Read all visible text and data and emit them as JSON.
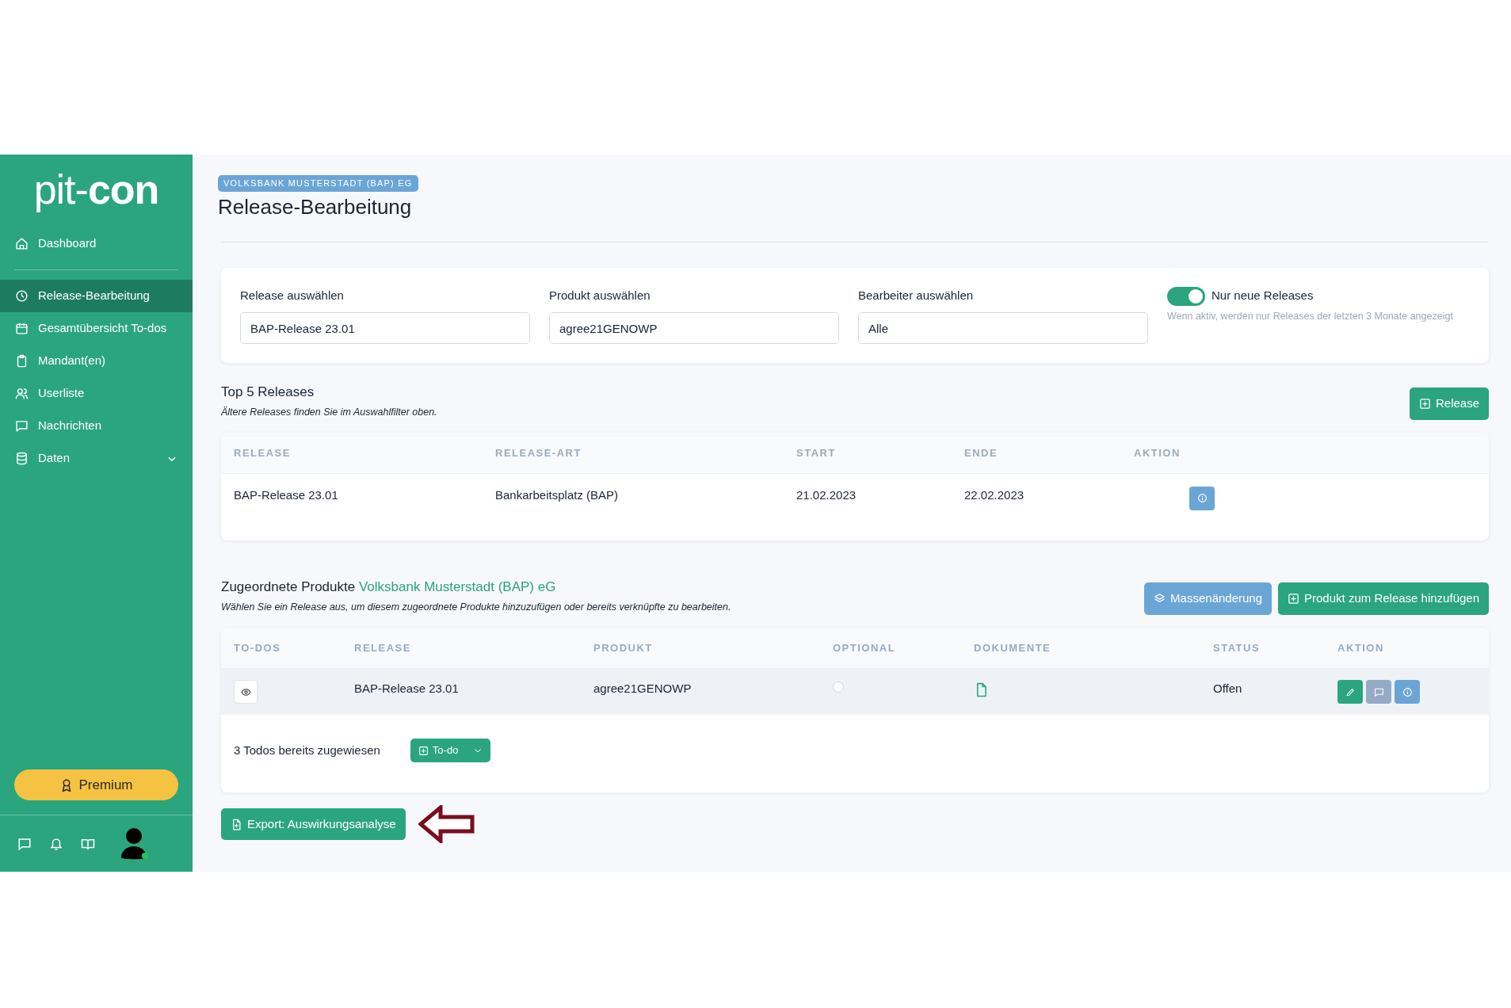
{
  "sidebar": {
    "logo": {
      "light": "pit-",
      "bold": "con"
    },
    "sections": [
      [
        {
          "label": "Dashboard",
          "selected": false
        }
      ],
      [
        {
          "label": "Release-Bearbeitung",
          "selected": true
        },
        {
          "label": "Gesamtübersicht To-dos",
          "selected": false
        },
        {
          "label": "Mandant(en)",
          "selected": false
        },
        {
          "label": "Userliste",
          "selected": false
        },
        {
          "label": "Nachrichten",
          "selected": false
        },
        {
          "label": "Daten",
          "selected": false,
          "expanded": false
        }
      ]
    ],
    "premium_button": "Premium"
  },
  "header": {
    "badge": "VOLKSBANK MUSTERSTADT (BAP) EG",
    "title": "Release-Bearbeitung"
  },
  "filters": [
    {
      "label": "Release auswählen",
      "value": "BAP-Release 23.01"
    },
    {
      "label": "Produkt auswählen",
      "value": "agree21GENOWP"
    },
    {
      "label": "Bearbeiter auswählen",
      "value": "Alle"
    }
  ],
  "toggle": {
    "label": "Nur neue Releases",
    "on": true,
    "hint": "Wenn aktiv, werden nur Releases der letzten 3 Monate angezeigt"
  },
  "top_releases": {
    "title": "Top 5 Releases",
    "subtitle": "Ältere Releases finden Sie im Auswahlfilter oben.",
    "add_button": "Release",
    "columns": [
      "RELEASE",
      "RELEASE-ART",
      "START",
      "ENDE",
      "AKTION"
    ],
    "rows": [
      [
        "BAP-Release 23.01",
        "Bankarbeitsplatz (BAP)",
        "21.02.2023",
        "22.02.2023"
      ]
    ]
  },
  "products": {
    "title": "Zugeordnete Produkte",
    "title_link": "Volksbank Musterstadt (BAP) eG",
    "subtitle": "Wählen Sie ein Release aus, um diesem zugeordnete Produkte hinzuzufügen oder bereits verknüpfte zu bearbeiten.",
    "buttons": [
      {
        "label": "Massenänderung",
        "kind": "secondary"
      },
      {
        "label": "Produkt zum Release hinzufügen",
        "kind": "primary"
      }
    ],
    "columns": [
      "TO-DOS",
      "RELEASE",
      "PRODUKT",
      "OPTIONAL",
      "DOKUMENTE",
      "STATUS",
      "AKTION"
    ],
    "rows": [
      {
        "release": "BAP-Release 23.01",
        "produkt": "agree21GENOWP",
        "optional": false,
        "status": "Offen"
      }
    ],
    "todos_note": "3 Todos bereits zugewiesen",
    "todo_button": "To-do"
  },
  "export_button": "Export: Auswirkungsanalyse"
}
